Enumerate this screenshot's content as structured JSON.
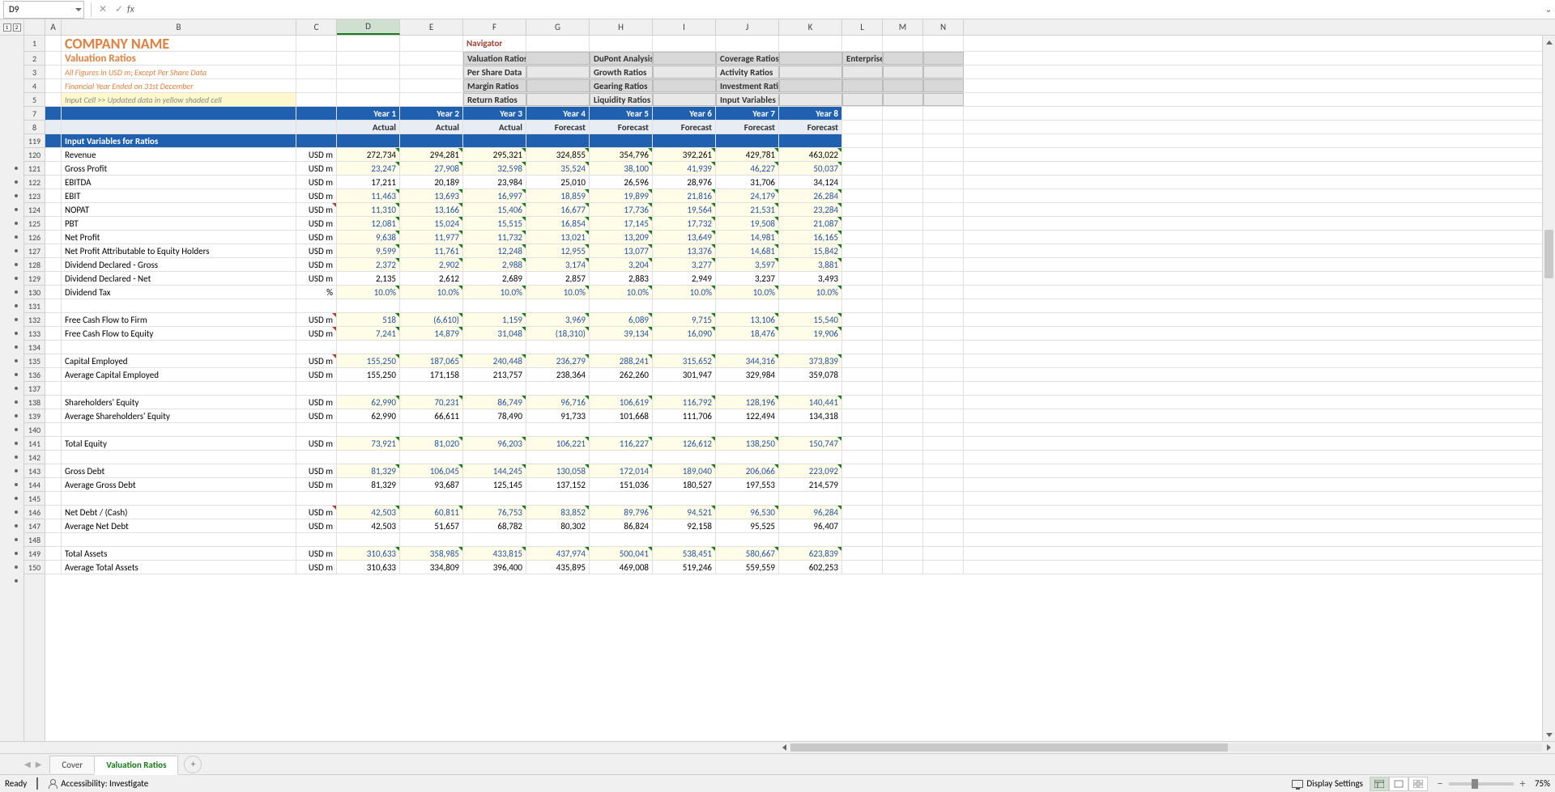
{
  "formula_bar": {
    "name_box": "D9",
    "formula": ""
  },
  "company": "COMPANY NAME",
  "section": "Valuation Ratios",
  "meta1": "All Figures in USD m; Except Per Share Data",
  "meta2": "Financial Year Ended on 31st December",
  "input_hint": "Input Cell >> Updated data in yellow shaded cell",
  "nav": {
    "title": "Navigator",
    "r1": [
      "Valuation Ratios",
      "DuPont Analysis",
      "Coverage Ratios",
      "Enterprise Value"
    ],
    "r2": [
      "Per Share Data",
      "Growth Ratios",
      "Activity Ratios",
      ""
    ],
    "r3": [
      "Margin Ratios",
      "Gearing Ratios",
      "Investment Ratios",
      ""
    ],
    "r4": [
      "Return Ratios",
      "Liquidity Ratios",
      "Input Variables for Ratios",
      ""
    ]
  },
  "years": [
    "Year 1",
    "Year 2",
    "Year 3",
    "Year 4",
    "Year 5",
    "Year 6",
    "Year 7",
    "Year 8"
  ],
  "subheads": [
    "Actual",
    "Actual",
    "Actual",
    "Forecast",
    "Forecast",
    "Forecast",
    "Forecast",
    "Forecast"
  ],
  "band": "Input Variables for Ratios",
  "cols": [
    "A",
    "B",
    "C",
    "D",
    "E",
    "F",
    "G",
    "H",
    "I",
    "J",
    "K",
    "L",
    "M",
    "N"
  ],
  "rownums_top": [
    "1",
    "2",
    "3",
    "4",
    "5",
    "7",
    "8",
    "119"
  ],
  "unit_usd": "USD m",
  "unit_pct": "%",
  "rows": [
    {
      "n": "120",
      "label": "Revenue",
      "unit": "USD m",
      "yel": true,
      "vals": [
        "272,734",
        "294,281",
        "295,321",
        "324,855",
        "354,796",
        "392,261",
        "429,781",
        "463,022"
      ]
    },
    {
      "n": "121",
      "label": "Gross Profit",
      "unit": "USD m",
      "yel": true,
      "blue": true,
      "vals": [
        "23,247",
        "27,908",
        "32,598",
        "35,524",
        "38,100",
        "41,939",
        "46,227",
        "50,037"
      ]
    },
    {
      "n": "122",
      "label": "EBITDA",
      "unit": "USD m",
      "yel": false,
      "vals": [
        "17,211",
        "20,189",
        "23,984",
        "25,010",
        "26,596",
        "28,976",
        "31,706",
        "34,124"
      ]
    },
    {
      "n": "123",
      "label": "EBIT",
      "unit": "USD m",
      "yel": true,
      "blue": true,
      "vals": [
        "11,463",
        "13,693",
        "16,997",
        "18,859",
        "19,899",
        "21,816",
        "24,179",
        "26,284"
      ]
    },
    {
      "n": "124",
      "label": "NOPAT",
      "unit": "USD m",
      "yel": true,
      "blue": true,
      "tri_c": true,
      "vals": [
        "11,310",
        "13,166",
        "15,406",
        "16,677",
        "17,736",
        "19,564",
        "21,531",
        "23,284"
      ]
    },
    {
      "n": "125",
      "label": "PBT",
      "unit": "USD m",
      "yel": true,
      "blue": true,
      "vals": [
        "12,081",
        "15,024",
        "15,515",
        "16,854",
        "17,145",
        "17,732",
        "19,508",
        "21,087"
      ]
    },
    {
      "n": "126",
      "label": "Net Profit",
      "unit": "USD m",
      "yel": true,
      "blue": true,
      "vals": [
        "9,638",
        "11,977",
        "11,732",
        "13,021",
        "13,209",
        "13,649",
        "14,981",
        "16,165"
      ]
    },
    {
      "n": "127",
      "label": "Net Profit Attributable to Equity Holders",
      "unit": "USD m",
      "yel": true,
      "blue": true,
      "vals": [
        "9,599",
        "11,761",
        "12,248",
        "12,955",
        "13,077",
        "13,376",
        "14,681",
        "15,842"
      ]
    },
    {
      "n": "128",
      "label": "Dividend Declared - Gross",
      "unit": "USD m",
      "yel": true,
      "blue": true,
      "vals": [
        "2,372",
        "2,902",
        "2,988",
        "3,174",
        "3,204",
        "3,277",
        "3,597",
        "3,881"
      ]
    },
    {
      "n": "129",
      "label": "Dividend Declared - Net",
      "unit": "USD m",
      "yel": false,
      "vals": [
        "2,135",
        "2,612",
        "2,689",
        "2,857",
        "2,883",
        "2,949",
        "3,237",
        "3,493"
      ]
    },
    {
      "n": "130",
      "label": "Dividend Tax",
      "unit": "%",
      "yel": true,
      "blue": true,
      "vals": [
        "10.0%",
        "10.0%",
        "10.0%",
        "10.0%",
        "10.0%",
        "10.0%",
        "10.0%",
        "10.0%"
      ]
    },
    {
      "n": "131",
      "label": "",
      "unit": "",
      "empty": true
    },
    {
      "n": "132",
      "label": "Free Cash Flow to Firm",
      "unit": "USD m",
      "yel": true,
      "blue": true,
      "tri_c": true,
      "vals": [
        "518",
        "(6,610)",
        "1,159",
        "3,969",
        "6,089",
        "9,715",
        "13,106",
        "15,540"
      ]
    },
    {
      "n": "133",
      "label": "Free Cash Flow to Equity",
      "unit": "USD m",
      "yel": true,
      "blue": true,
      "tri_c": true,
      "vals": [
        "7,241",
        "14,879",
        "31,048",
        "(18,310)",
        "39,134",
        "16,090",
        "18,476",
        "19,906"
      ]
    },
    {
      "n": "134",
      "label": "",
      "unit": "",
      "empty": true
    },
    {
      "n": "135",
      "label": "Capital Employed",
      "unit": "USD m",
      "yel": true,
      "blue": true,
      "tri_c": true,
      "vals": [
        "155,250",
        "187,065",
        "240,448",
        "236,279",
        "288,241",
        "315,652",
        "344,316",
        "373,839"
      ]
    },
    {
      "n": "136",
      "label": "Average Capital Employed",
      "unit": "USD m",
      "yel": false,
      "vals": [
        "155,250",
        "171,158",
        "213,757",
        "238,364",
        "262,260",
        "301,947",
        "329,984",
        "359,078"
      ]
    },
    {
      "n": "137",
      "label": "",
      "unit": "",
      "empty": true
    },
    {
      "n": "138",
      "label": "Shareholders' Equity",
      "unit": "USD m",
      "yel": true,
      "blue": true,
      "vals": [
        "62,990",
        "70,231",
        "86,749",
        "96,716",
        "106,619",
        "116,792",
        "128,196",
        "140,441"
      ]
    },
    {
      "n": "139",
      "label": "Average Shareholders' Equity",
      "unit": "USD m",
      "yel": false,
      "vals": [
        "62,990",
        "66,611",
        "78,490",
        "91,733",
        "101,668",
        "111,706",
        "122,494",
        "134,318"
      ]
    },
    {
      "n": "140",
      "label": "",
      "unit": "",
      "empty": true
    },
    {
      "n": "141",
      "label": "Total Equity",
      "unit": "USD m",
      "yel": true,
      "blue": true,
      "vals": [
        "73,921",
        "81,020",
        "96,203",
        "106,221",
        "116,227",
        "126,612",
        "138,250",
        "150,747"
      ]
    },
    {
      "n": "142",
      "label": "",
      "unit": "",
      "empty": true
    },
    {
      "n": "143",
      "label": "Gross Debt",
      "unit": "USD m",
      "yel": true,
      "blue": true,
      "vals": [
        "81,329",
        "106,045",
        "144,245",
        "130,058",
        "172,014",
        "189,040",
        "206,066",
        "223,092"
      ]
    },
    {
      "n": "144",
      "label": "Average Gross Debt",
      "unit": "USD m",
      "yel": false,
      "vals": [
        "81,329",
        "93,687",
        "125,145",
        "137,152",
        "151,036",
        "180,527",
        "197,553",
        "214,579"
      ]
    },
    {
      "n": "145",
      "label": "",
      "unit": "",
      "empty": true
    },
    {
      "n": "146",
      "label": "Net Debt / (Cash)",
      "unit": "USD m",
      "yel": true,
      "blue": true,
      "tri_c": true,
      "vals": [
        "42,503",
        "60,811",
        "76,753",
        "83,852",
        "89,796",
        "94,521",
        "96,530",
        "96,284"
      ]
    },
    {
      "n": "147",
      "label": "Average Net Debt",
      "unit": "USD m",
      "yel": false,
      "vals": [
        "42,503",
        "51,657",
        "68,782",
        "80,302",
        "86,824",
        "92,158",
        "95,525",
        "96,407"
      ]
    },
    {
      "n": "148",
      "label": "",
      "unit": "",
      "empty": true
    },
    {
      "n": "149",
      "label": "Total Assets",
      "unit": "USD m",
      "yel": true,
      "blue": true,
      "vals": [
        "310,633",
        "358,985",
        "433,815",
        "437,974",
        "500,041",
        "538,451",
        "580,667",
        "623,839"
      ]
    },
    {
      "n": "150",
      "label": "Average Total Assets",
      "unit": "USD m",
      "yel": false,
      "partial": true,
      "vals": [
        "310,633",
        "334,809",
        "396,400",
        "435,895",
        "469,008",
        "519,246",
        "559,559",
        "602,253"
      ]
    }
  ],
  "sheets": {
    "tabs": [
      "Cover",
      "Valuation Ratios"
    ],
    "active": 1
  },
  "status": {
    "ready": "Ready",
    "accessibility": "Accessibility: Investigate",
    "display": "Display Settings",
    "zoom": "75%"
  }
}
